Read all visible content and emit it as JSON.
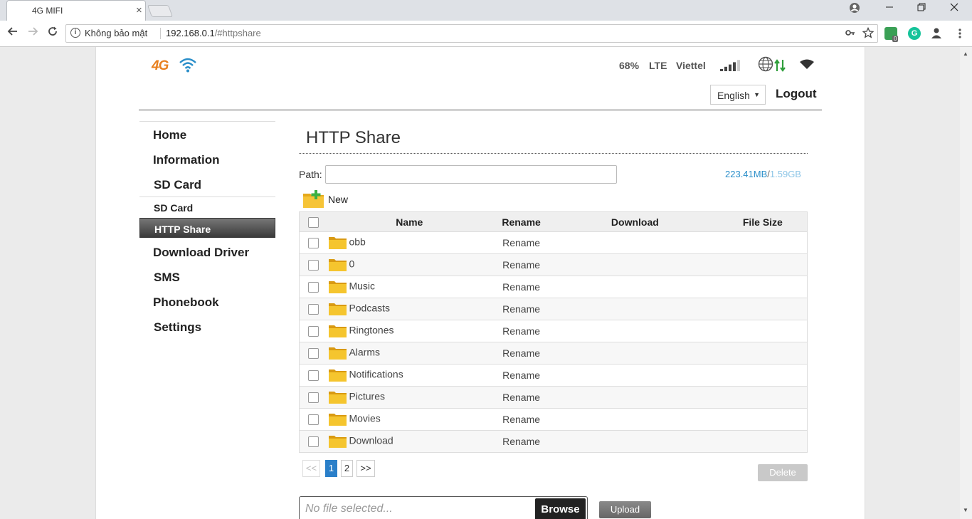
{
  "browser": {
    "tab_title": "4G MIFI",
    "tab_close": "×",
    "secure_label": "Không bảo mật",
    "url_host": "192.168.0.1",
    "url_path": "/#httpshare",
    "ext_badge": "0"
  },
  "header": {
    "logo_text": "4G",
    "battery": "68%",
    "network_type": "LTE",
    "carrier": "Viettel",
    "signal_bars_active": 4,
    "signal_bars_total": 5,
    "language": "English",
    "logout": "Logout"
  },
  "sidebar": {
    "items": [
      {
        "label": "Home"
      },
      {
        "label": "Information"
      },
      {
        "label": "SD Card"
      },
      {
        "label": "SD Card"
      },
      {
        "label": "HTTP Share"
      },
      {
        "label": "Download Driver"
      },
      {
        "label": "SMS"
      },
      {
        "label": "Phonebook"
      },
      {
        "label": "Settings"
      }
    ]
  },
  "main": {
    "title": "HTTP Share",
    "path_label": "Path:",
    "path_value": "",
    "storage_used": "223.41MB",
    "storage_sep": "/",
    "storage_total": "1.59GB",
    "new_label": "New",
    "columns": [
      "Name",
      "Rename",
      "Download",
      "File Size"
    ],
    "rows": [
      {
        "name": "obb",
        "rename": "Rename",
        "download": "",
        "size": ""
      },
      {
        "name": "0",
        "rename": "Rename",
        "download": "",
        "size": ""
      },
      {
        "name": "Music",
        "rename": "Rename",
        "download": "",
        "size": ""
      },
      {
        "name": "Podcasts",
        "rename": "Rename",
        "download": "",
        "size": ""
      },
      {
        "name": "Ringtones",
        "rename": "Rename",
        "download": "",
        "size": ""
      },
      {
        "name": "Alarms",
        "rename": "Rename",
        "download": "",
        "size": ""
      },
      {
        "name": "Notifications",
        "rename": "Rename",
        "download": "",
        "size": ""
      },
      {
        "name": "Pictures",
        "rename": "Rename",
        "download": "",
        "size": ""
      },
      {
        "name": "Movies",
        "rename": "Rename",
        "download": "",
        "size": ""
      },
      {
        "name": "Download",
        "rename": "Rename",
        "download": "",
        "size": ""
      }
    ],
    "pager": {
      "prev": "<<",
      "pages": [
        "1",
        "2"
      ],
      "current": "1",
      "next": ">>"
    },
    "delete_label": "Delete",
    "file_placeholder": "No file selected...",
    "browse_label": "Browse",
    "upload_label": "Upload"
  },
  "colors": {
    "accent_blue": "#2a7fc9",
    "logo_orange": "#e8801f",
    "data_arrow_green": "#2e9e3a"
  }
}
